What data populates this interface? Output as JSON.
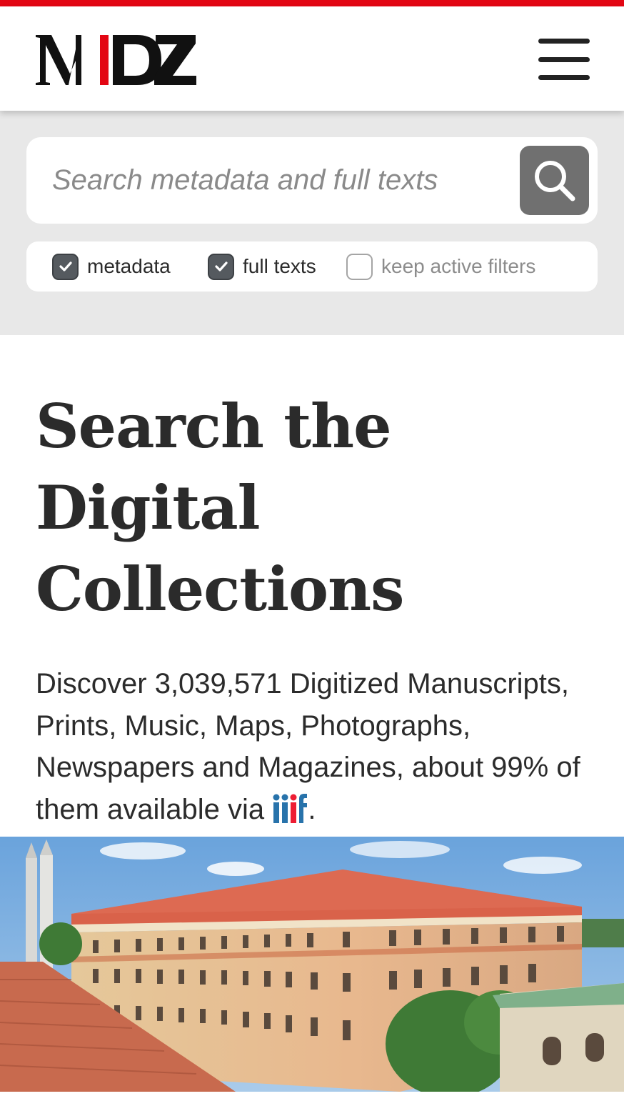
{
  "colors": {
    "accent": "#e30613",
    "panel_bg": "#e8e8e8",
    "search_button_bg": "#707070",
    "checkbox_checked": "#555a5f",
    "iiif_blue": "#2873ab",
    "iiif_red": "#ed1d33"
  },
  "header": {
    "logo_text": "MDZ",
    "menu_icon": "hamburger-menu-icon"
  },
  "search": {
    "placeholder": "Search metadata and full texts",
    "value": "",
    "button_icon": "search-icon",
    "options": [
      {
        "label": "metadata",
        "checked": true
      },
      {
        "label": "full texts",
        "checked": true
      },
      {
        "label": "keep active filters",
        "checked": false
      }
    ]
  },
  "main": {
    "title": "Search the Digital Collections",
    "intro_text": "Discover 3,039,571 Digitized Manuscripts, Prints, Music, Maps, Photographs, Newspapers and Magazines, about 99% of them available via",
    "intro_suffix": ".",
    "iiif_logo_text": "iiif"
  },
  "hero": {
    "image": "library-building-photo"
  }
}
